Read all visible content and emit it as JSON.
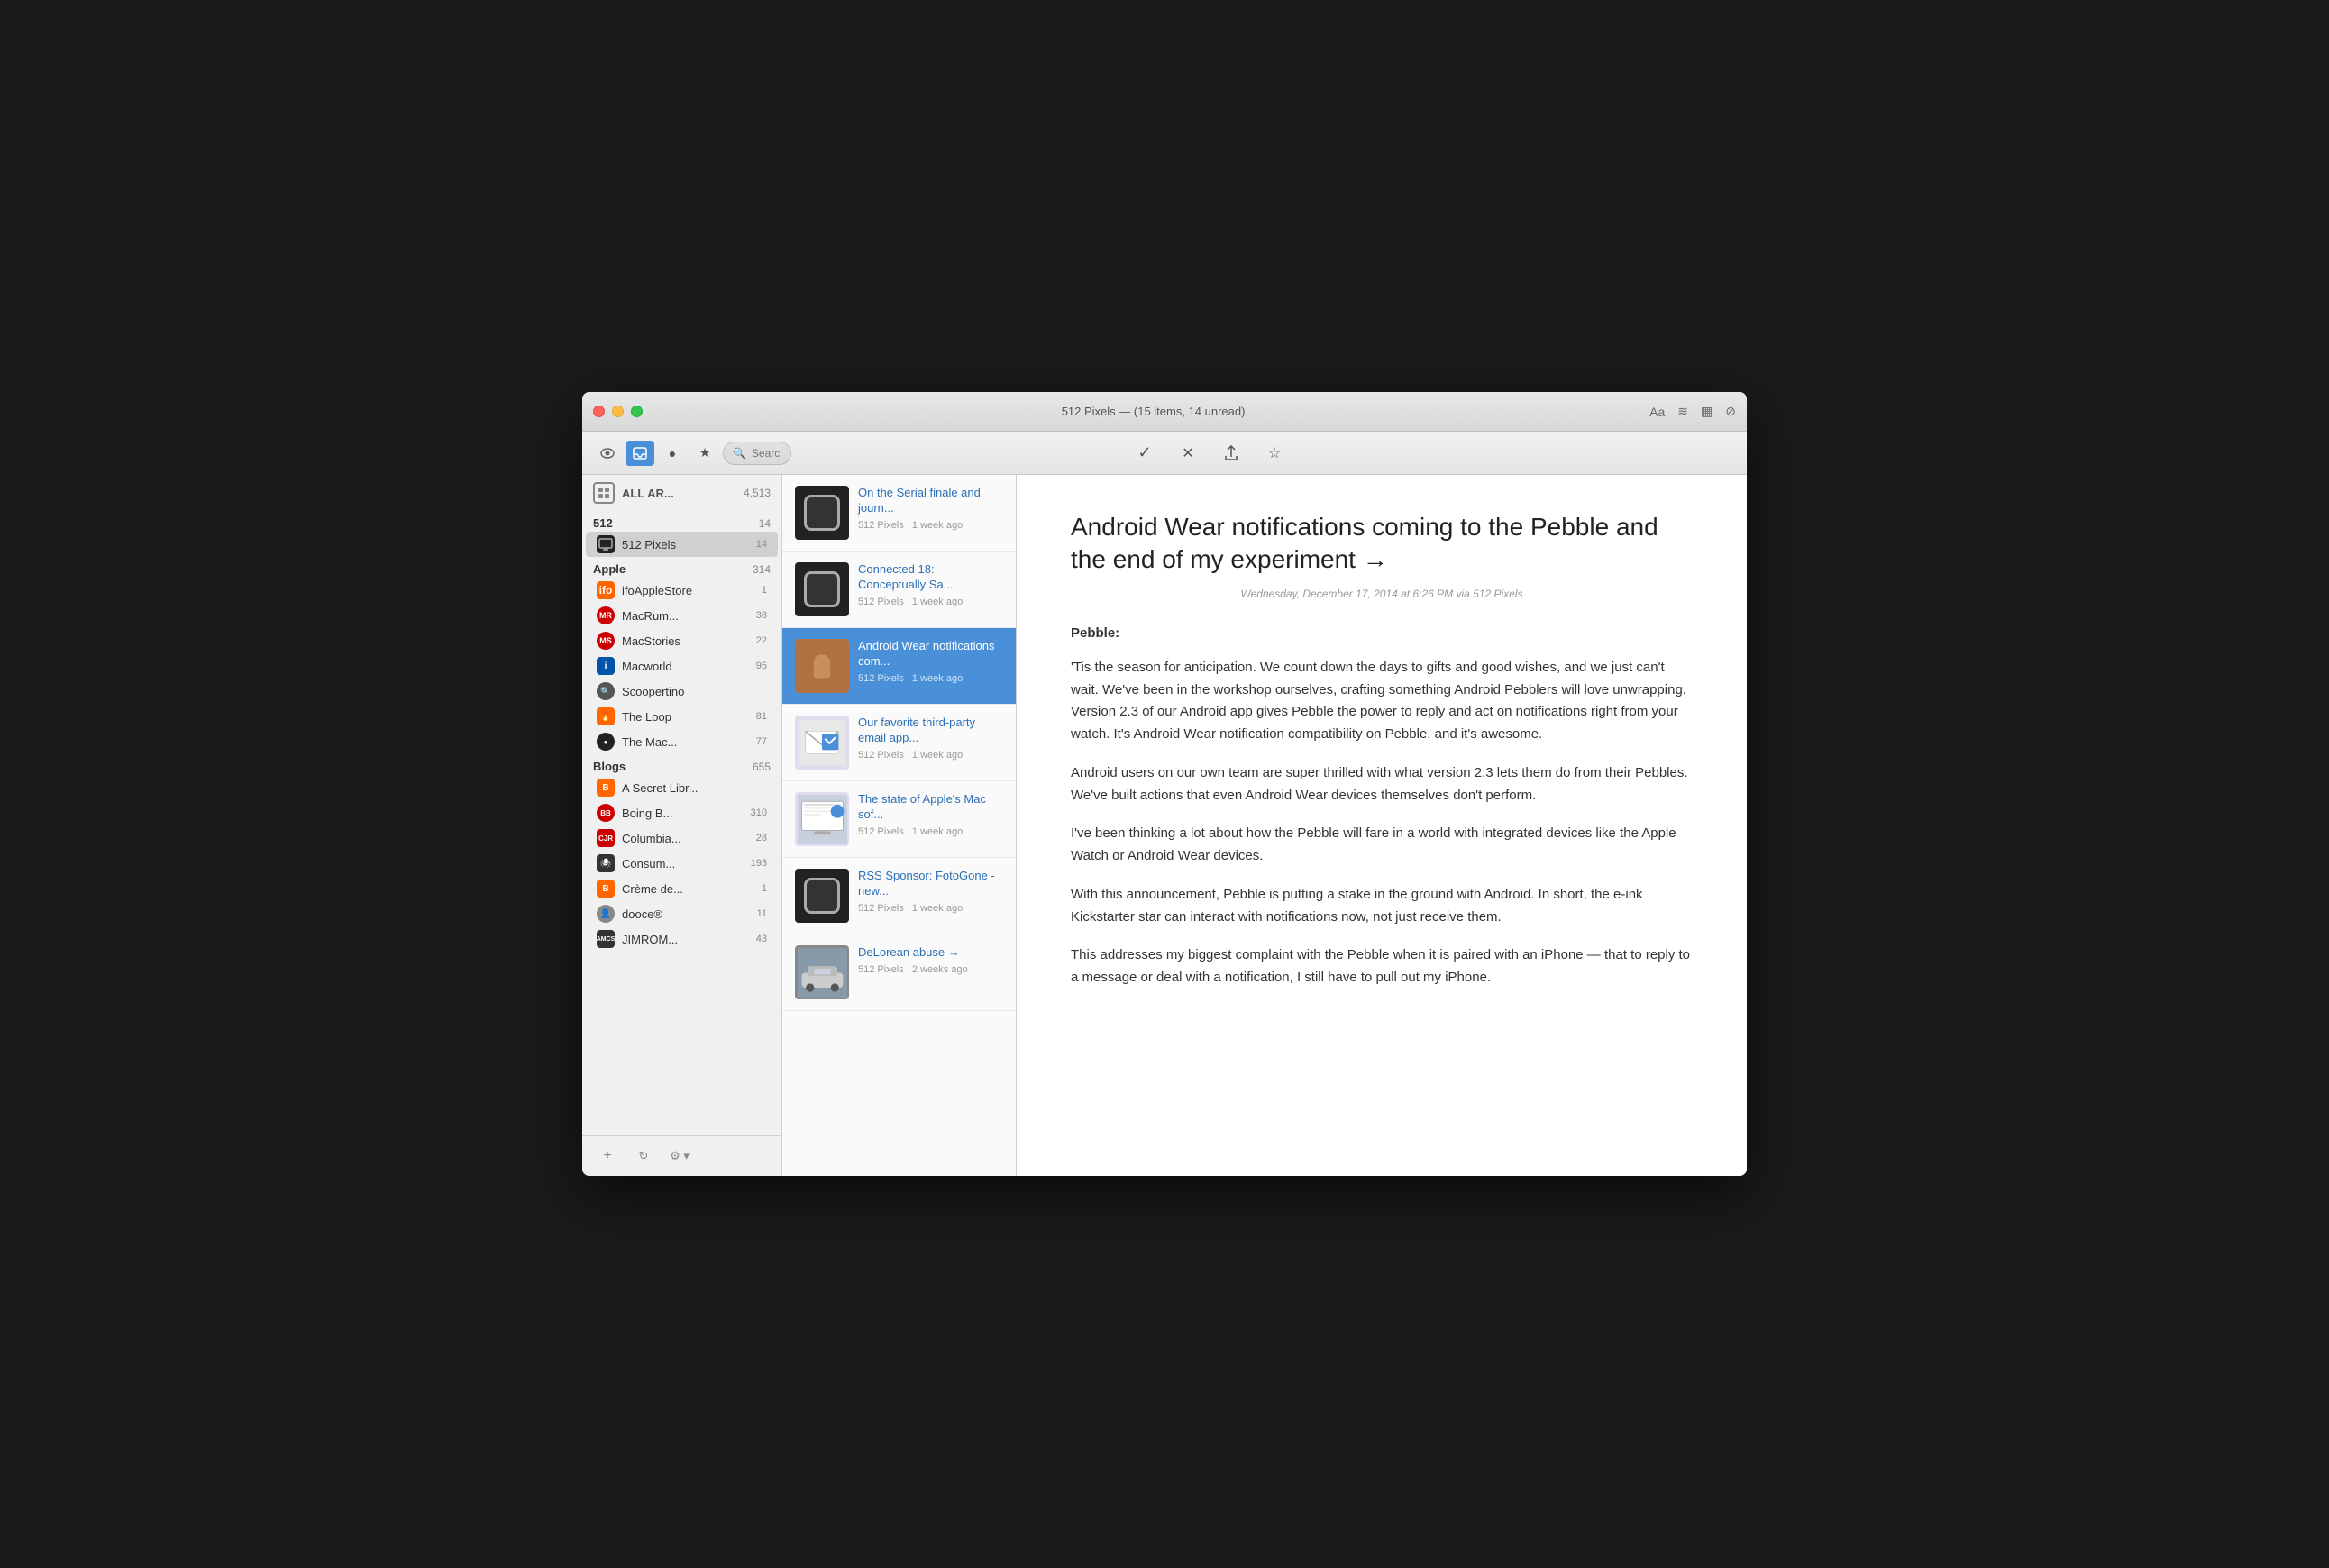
{
  "window": {
    "title": "512 Pixels — (15 items, 14 unread)"
  },
  "toolbar": {
    "search_placeholder": "Search",
    "font_label": "Aa",
    "icons": [
      "eye",
      "inbox",
      "circle",
      "star",
      "checkmark",
      "x",
      "share",
      "star-outline",
      "font",
      "rss",
      "grid",
      "no-entry"
    ]
  },
  "sidebar": {
    "all_articles": {
      "name": "ALL AR...",
      "count": "4,513"
    },
    "section_512": {
      "name": "512",
      "count": "14",
      "feeds": [
        {
          "name": "512 Pixels",
          "count": "14",
          "icon": "monitor",
          "active": true
        }
      ]
    },
    "section_apple": {
      "name": "Apple",
      "count": "314",
      "feeds": [
        {
          "name": "ifoAppleStore",
          "count": "1",
          "color": "#f60"
        },
        {
          "name": "MacRum...",
          "count": "38",
          "color": "#c00"
        },
        {
          "name": "MacStories",
          "count": "22",
          "color": "#c00"
        },
        {
          "name": "Macworld",
          "count": "95",
          "color": "#0055aa"
        },
        {
          "name": "Scoopertino",
          "count": "",
          "color": "#555"
        },
        {
          "name": "The Loop",
          "count": "81",
          "color": "#f60"
        },
        {
          "name": "The Mac...",
          "count": "77",
          "color": "#222"
        }
      ]
    },
    "section_blogs": {
      "name": "Blogs",
      "count": "655",
      "feeds": [
        {
          "name": "A Secret Libr...",
          "count": "",
          "color": "#f60"
        },
        {
          "name": "Boing B...",
          "count": "310",
          "color": "#c00"
        },
        {
          "name": "Columbia...",
          "count": "28",
          "color": "#cc0000"
        },
        {
          "name": "Consum...",
          "count": "193",
          "color": "#333"
        },
        {
          "name": "Crème de...",
          "count": "1",
          "color": "#f60"
        },
        {
          "name": "dooce®",
          "count": "11",
          "color": "#888"
        },
        {
          "name": "JIMROM...",
          "count": "43",
          "color": "#333"
        }
      ]
    }
  },
  "articles": [
    {
      "title": "On the Serial finale and journ...",
      "source": "512 Pixels",
      "time": "1 week ago",
      "active": false,
      "thumb_type": "pebble"
    },
    {
      "title": "Connected 18: Conceptually Sa...",
      "source": "512 Pixels",
      "time": "1 week ago",
      "active": false,
      "thumb_type": "pebble"
    },
    {
      "title": "Android Wear notifications com...",
      "source": "512 Pixels",
      "time": "1 week ago",
      "active": true,
      "thumb_type": "android"
    },
    {
      "title": "Our favorite third-party email app...",
      "source": "512 Pixels",
      "time": "1 week ago",
      "active": false,
      "thumb_type": "email"
    },
    {
      "title": "The state of Apple's Mac sof...",
      "source": "512 Pixels",
      "time": "1 week ago",
      "active": false,
      "thumb_type": "mac"
    },
    {
      "title": "RSS Sponsor: FotoGone - new...",
      "source": "512 Pixels",
      "time": "1 week ago",
      "active": false,
      "thumb_type": "pebble"
    },
    {
      "title": "DeLorean abuse →",
      "source": "512 Pixels",
      "time": "2 weeks ago",
      "active": false,
      "thumb_type": "car"
    }
  ],
  "article": {
    "title": "Android Wear notifications coming to the Pebble and the end of my experiment →",
    "date": "Wednesday, December 17, 2014 at 6:26 PM via 512 Pixels",
    "author": "Pebble:",
    "paragraphs": [
      "'Tis the season for anticipation. We count down the days to gifts and good wishes, and we just can't wait. We've been in the workshop ourselves, crafting something Android Pebblers will love unwrapping. Version 2.3 of our Android app gives Pebble the power to reply and act on notifications right from your watch. It's Android Wear notification compatibility on Pebble, and it's awesome.",
      "Android users on our own team are super thrilled with what version 2.3 lets them do from their Pebbles. We've built actions that even Android Wear devices themselves don't perform.",
      "I've been thinking a lot about how the Pebble will fare in a world with integrated devices like the Apple Watch or Android Wear devices.",
      "With this announcement, Pebble is putting a stake in the ground with Android. In short, the e-ink Kickstarter star can interact with notifications now, not just receive them.",
      "This addresses my biggest complaint with the Pebble when it is paired with an iPhone — that to reply to a message or deal with a notification, I still have to pull out my iPhone."
    ]
  }
}
